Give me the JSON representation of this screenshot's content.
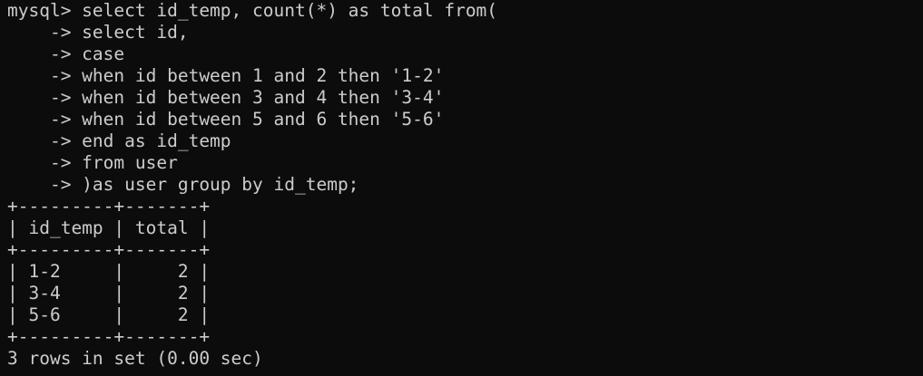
{
  "terminal": {
    "lines": [
      "mysql> select id_temp, count(*) as total from(",
      "    -> select id,",
      "    -> case",
      "    -> when id between 1 and 2 then '1-2'",
      "    -> when id between 3 and 4 then '3-4'",
      "    -> when id between 5 and 6 then '5-6'",
      "    -> end as id_temp",
      "    -> from user",
      "    -> )as user group by id_temp;",
      "+---------+-------+",
      "| id_temp | total |",
      "+---------+-------+",
      "| 1-2     |     2 |",
      "| 3-4     |     2 |",
      "| 5-6     |     2 |",
      "+---------+-------+",
      "3 rows in set (0.00 sec)"
    ]
  }
}
